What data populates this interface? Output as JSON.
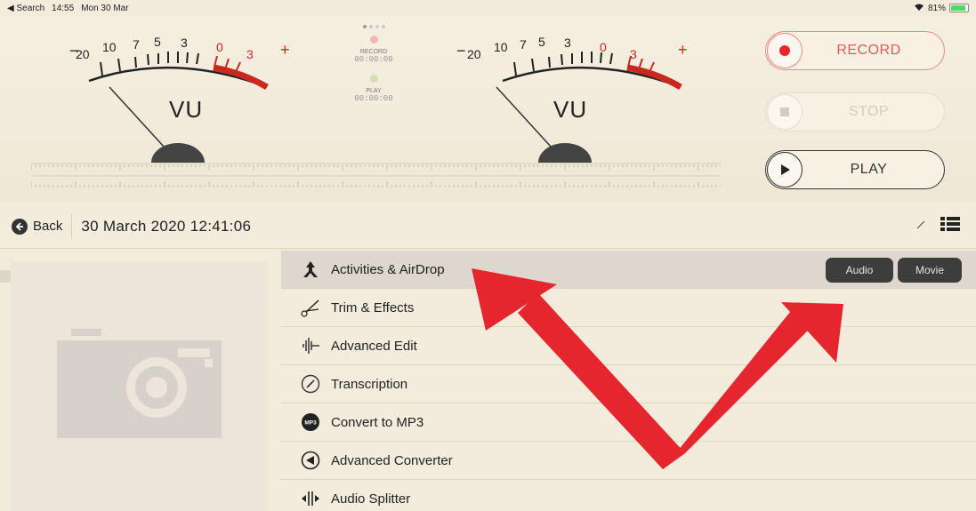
{
  "status_bar": {
    "back_app": "◀ Search",
    "time": "14:55",
    "date": "Mon 30 Mar",
    "battery": "81%"
  },
  "meters": [
    {
      "label": "VU",
      "scale": [
        "−",
        "20",
        "10",
        "7",
        "5",
        "3",
        "0",
        "3",
        "+"
      ]
    },
    {
      "label": "VU",
      "scale": [
        "−",
        "20",
        "10",
        "7",
        "5",
        "3",
        "0",
        "3",
        "+"
      ]
    }
  ],
  "center_status": {
    "record_label": "RECORD",
    "record_time": "00:00:00",
    "play_label": "PLAY",
    "play_time": "00:00:00"
  },
  "transport": {
    "record_label": "RECORD",
    "stop_label": "STOP",
    "play_label": "PLAY"
  },
  "nav": {
    "back_label": "Back",
    "title": "30 March 2020 12:41:06"
  },
  "menu": {
    "items": [
      {
        "label": "Activities & AirDrop",
        "icon": "airdrop-icon"
      },
      {
        "label": "Trim & Effects",
        "icon": "scissors-icon"
      },
      {
        "label": "Advanced Edit",
        "icon": "waveform-icon"
      },
      {
        "label": "Transcription",
        "icon": "pencil-circle-icon"
      },
      {
        "label": "Convert to MP3",
        "icon": "mp3-icon"
      },
      {
        "label": "Advanced Converter",
        "icon": "converter-icon"
      },
      {
        "label": "Audio Splitter",
        "icon": "splitter-icon"
      }
    ],
    "audio_button": "Audio",
    "movie_button": "Movie",
    "mp3_badge": "MP3"
  },
  "colors": {
    "accent_red": "#e6262e",
    "record_red": "#e45b55",
    "background": "#f3ecdd"
  }
}
